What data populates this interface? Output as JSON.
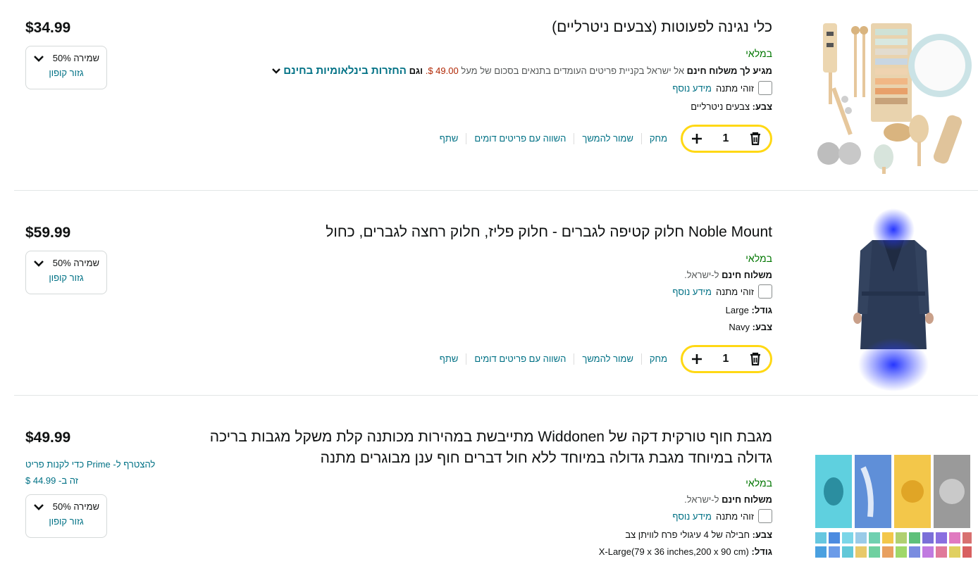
{
  "items": [
    {
      "title": "כלי נגינה לפעוטות (צבעים ניטרליים)",
      "availability": "במלאי",
      "shipping_prefix": "מגיע לך משלוח חינם",
      "shipping_mid": "אל ישראל בקניית פריטים העומדים בתנאים בסכום של מעל",
      "shipping_amount": "49.00 $.",
      "shipping_also": "וגם",
      "intl_returns": "החזרות בינלאומיות בחינם",
      "gift_label": "זוהי מתנה",
      "gift_more": "מידע נוסף",
      "color_label": "צבע:",
      "color_value": "צבעים ניטרליים",
      "quantity": "1",
      "delete": "מחק",
      "save_later": "שמור להמשך",
      "compare": "השווה עם פריטים דומים",
      "share": "שתף",
      "price": "$34.99",
      "coupon_saving": "שמירה 50%",
      "coupon_clip": "גזור קופון"
    },
    {
      "title": "Noble Mount חלוק קטיפה לגברים - חלוק פליז, חלוק רחצה לגברים, כחול",
      "availability": "במלאי",
      "shipping_prefix": "משלוח חינם",
      "shipping_suffix": "ל-ישראל.",
      "gift_label": "זוהי מתנה",
      "gift_more": "מידע נוסף",
      "size_label": "גודל:",
      "size_value": "Large",
      "color_label": "צבע:",
      "color_value": "Navy",
      "quantity": "1",
      "delete": "מחק",
      "save_later": "שמור להמשך",
      "compare": "השווה עם פריטים דומים",
      "share": "שתף",
      "price": "$59.99",
      "coupon_saving": "שמירה 50%",
      "coupon_clip": "גזור קופון"
    },
    {
      "title": "מגבת חוף טורקית דקה של Widdonen מתייבשת במהירות מכותנה קלת משקל מגבות בריכה גדולה במיוחד מגבת גדולה במיוחד ללא חול דברים חוף ענן מבוגרים מתנה",
      "availability": "במלאי",
      "shipping_prefix": "משלוח חינם",
      "shipping_suffix": "ל-ישראל.",
      "gift_label": "זוהי מתנה",
      "gift_more": "מידע נוסף",
      "color_label": "צבע:",
      "color_value": "חבילה של 4 עיגולי פרח לוויתן צב",
      "size_label": "גודל:",
      "size_value": "X-Large(79 x 36 inches,200 x 90 cm)",
      "price": "$49.99",
      "prime_line1": "להצטרף ל- Prime כדי לקנות פריט",
      "prime_line2": "זה ב- 44.99 $",
      "coupon_saving": "שמירה 50%",
      "coupon_clip": "גזור קופון"
    }
  ],
  "icons": {
    "trash": "trash-icon",
    "plus": "plus-icon",
    "chevron": "chevron-down-icon"
  },
  "colors": {
    "link": "#007185",
    "in_stock": "#007600",
    "amount": "#b12704",
    "qty_border": "#ffd814"
  }
}
